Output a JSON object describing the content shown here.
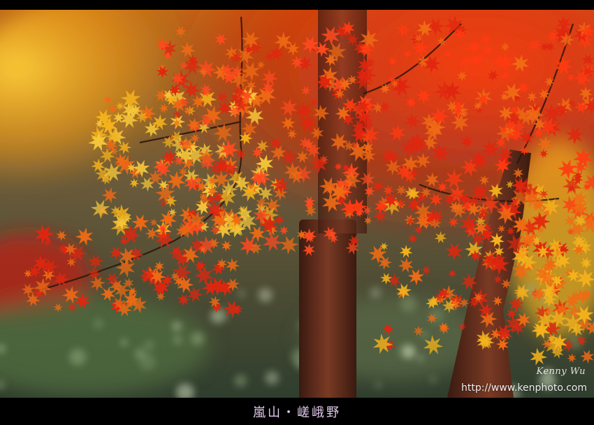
{
  "photo": {
    "description_icon": "autumn-maple-photo",
    "palette": {
      "red": "#e0260f",
      "orange": "#f06a14",
      "yellow": "#f5b21c",
      "trunk": "#6a3220",
      "background": "#3b4a3a"
    }
  },
  "watermark": {
    "signature": "Kenny Wu",
    "url": "http://www.kenphoto.com"
  },
  "caption": {
    "text": "嵐山・嵯峨野"
  }
}
